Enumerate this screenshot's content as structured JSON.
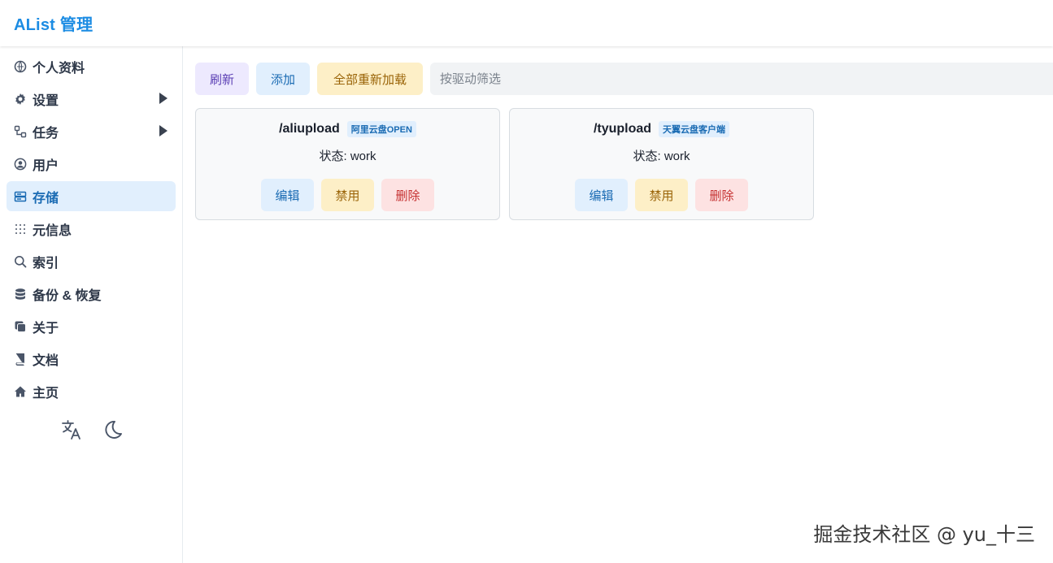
{
  "header": {
    "brand": "AList 管理"
  },
  "sidebar": {
    "items": [
      {
        "label": "个人资料",
        "icon": "profile-icon",
        "submenu": false,
        "active": false
      },
      {
        "label": "设置",
        "icon": "gear-icon",
        "submenu": true,
        "active": false
      },
      {
        "label": "任务",
        "icon": "tasks-icon",
        "submenu": true,
        "active": false
      },
      {
        "label": "用户",
        "icon": "user-icon",
        "submenu": false,
        "active": false
      },
      {
        "label": "存储",
        "icon": "storage-icon",
        "submenu": false,
        "active": true
      },
      {
        "label": "元信息",
        "icon": "meta-icon",
        "submenu": false,
        "active": false
      },
      {
        "label": "索引",
        "icon": "search-icon",
        "submenu": false,
        "active": false
      },
      {
        "label": "备份 & 恢复",
        "icon": "database-icon",
        "submenu": false,
        "active": false
      },
      {
        "label": "关于",
        "icon": "about-icon",
        "submenu": false,
        "active": false
      },
      {
        "label": "文档",
        "icon": "book-icon",
        "submenu": false,
        "active": false
      },
      {
        "label": "主页",
        "icon": "home-icon",
        "submenu": false,
        "active": false
      }
    ],
    "tools": [
      "translate-icon",
      "moon-icon"
    ]
  },
  "toolbar": {
    "refresh_label": "刷新",
    "add_label": "添加",
    "reload_all_label": "全部重新加载",
    "filter_placeholder": "按驱动筛选"
  },
  "storages": [
    {
      "mount": "/aliupload",
      "driver": "阿里云盘OPEN",
      "status": "状态: work",
      "edit": "编辑",
      "disable": "禁用",
      "delete": "删除"
    },
    {
      "mount": "/tyupload",
      "driver": "天翼云盘客户端",
      "status": "状态: work",
      "edit": "编辑",
      "disable": "禁用",
      "delete": "删除"
    }
  ],
  "watermark": "掘金技术社区 @ yu_十三",
  "colors": {
    "accent": "#1c8ce3",
    "active_bg": "#e1effd",
    "warning_bg": "#fdefc7",
    "danger_bg": "#fde2e2",
    "purple_bg": "#ede9fe"
  }
}
